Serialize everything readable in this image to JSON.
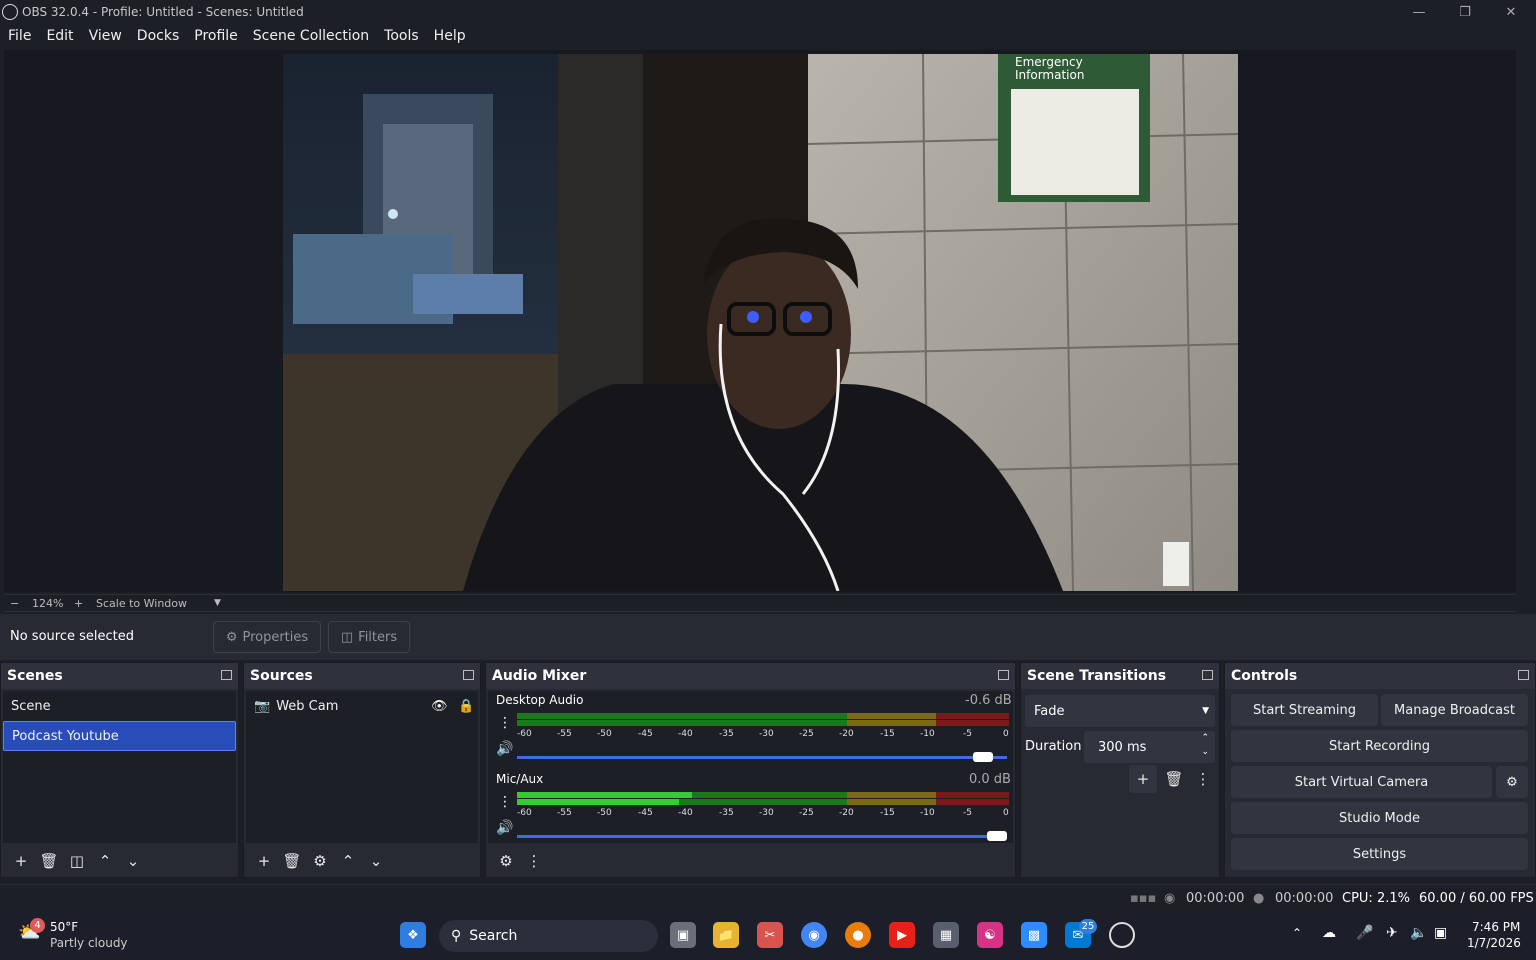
{
  "window": {
    "title": "OBS 32.0.4 - Profile: Untitled - Scenes: Untitled"
  },
  "menu": [
    "File",
    "Edit",
    "View",
    "Docks",
    "Profile",
    "Scene Collection",
    "Tools",
    "Help"
  ],
  "zoom": {
    "value": "124%",
    "mode": "Scale to Window"
  },
  "context": {
    "no_source": "No source selected",
    "properties": "Properties",
    "filters": "Filters"
  },
  "scenes": {
    "title": "Scenes",
    "items": [
      "Scene",
      "Podcast Youtube"
    ],
    "selected": 1
  },
  "sources": {
    "title": "Sources",
    "items": [
      {
        "label": "Web Cam"
      }
    ]
  },
  "mixer": {
    "title": "Audio Mixer",
    "ticks": [
      "-60",
      "-55",
      "-50",
      "-45",
      "-40",
      "-35",
      "-30",
      "-25",
      "-20",
      "-15",
      "-10",
      "-5",
      "0"
    ],
    "channels": [
      {
        "name": "Desktop Audio",
        "db": "-0.6 dB"
      },
      {
        "name": "Mic/Aux",
        "db": "0.0 dB"
      }
    ]
  },
  "transitions": {
    "title": "Scene Transitions",
    "selected": "Fade",
    "duration_label": "Duration",
    "duration": "300 ms"
  },
  "controls": {
    "title": "Controls",
    "start_streaming": "Start Streaming",
    "manage_broadcast": "Manage Broadcast",
    "start_recording": "Start Recording",
    "start_virtual_camera": "Start Virtual Camera",
    "studio_mode": "Studio Mode",
    "settings": "Settings"
  },
  "status": {
    "stream_time": "00:00:00",
    "record_time": "00:00:00",
    "cpu": "CPU: 2.1%",
    "fps": "60.00 / 60.00 FPS"
  },
  "taskbar": {
    "weather_temp": "50°F",
    "weather_desc": "Partly cloudy",
    "weather_badge": "4",
    "search": "Search",
    "teams_badge": "25",
    "time": "7:46 PM",
    "date": "1/7/2026"
  },
  "preview": {
    "sign_text": "Emergency Information"
  },
  "colors": {
    "accent": "#284cb8",
    "slider": "#3e6be8",
    "meter_green": "#33cc33"
  }
}
